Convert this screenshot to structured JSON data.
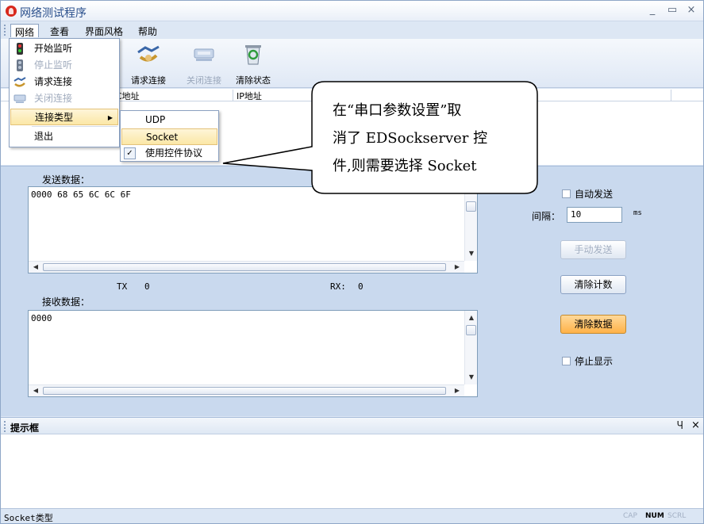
{
  "window": {
    "title": "网络测试程序",
    "minimize_glyph": "_",
    "maximize_glyph": "▭",
    "close_glyph": "×"
  },
  "menubar": {
    "items": [
      "网络",
      "查看",
      "界面风格",
      "帮助"
    ]
  },
  "toolbar": {
    "buttons": [
      {
        "label": "请求连接",
        "enabled": true
      },
      {
        "label": "关闭连接",
        "enabled": false
      },
      {
        "label": "清除状态",
        "enabled": true
      }
    ]
  },
  "list": {
    "columns": [
      "C地址",
      "IP地址"
    ]
  },
  "network_menu": {
    "items": [
      {
        "label": "开始监听",
        "icon": "traffic-light-icon",
        "enabled": true
      },
      {
        "label": "停止监听",
        "icon": "traffic-light-icon",
        "enabled": false
      },
      {
        "label": "请求连接",
        "icon": "handshake-icon",
        "enabled": true
      },
      {
        "label": "关闭连接",
        "icon": "disconnect-icon",
        "enabled": false
      },
      {
        "label": "连接类型",
        "submenu": true,
        "arrow": "▶"
      },
      {
        "label": "退出"
      }
    ]
  },
  "conn_type_submenu": {
    "items": [
      {
        "label": "UDP"
      },
      {
        "label": "Socket",
        "highlighted": true
      },
      {
        "label": "使用控件协议",
        "checked": true,
        "check_glyph": "✓"
      }
    ]
  },
  "send": {
    "label": "发送数据：",
    "content": "0000 68 65 6C 6C 6F"
  },
  "counters": {
    "tx_label": "TX",
    "tx_value": "0",
    "rx_label": "RX:",
    "rx_value": "0"
  },
  "receive": {
    "label": "接收数据：",
    "content": "0000"
  },
  "controls": {
    "auto_send_label": "自动发送",
    "interval_label": "间隔：",
    "interval_value": "10",
    "interval_unit": "ms",
    "manual_send": "手动发送",
    "clear_count": "清除计数",
    "clear_data": "清除数据",
    "stop_display": "停止显示"
  },
  "dock": {
    "title": "提示框",
    "pin_glyph": "Ⴗ",
    "close_glyph": "×"
  },
  "status": {
    "text": "Socket类型",
    "indicators": [
      "CAP",
      "NUM",
      "SCRL"
    ]
  },
  "callout": {
    "lines": [
      "在“串口参数设置”取",
      "消了 EDSockserver 控",
      "件,则需要选择 Socket"
    ]
  },
  "colors": {
    "accent": "#2a4f8c",
    "panel": "#c9d9ee",
    "focus_button": "#ffb248"
  }
}
